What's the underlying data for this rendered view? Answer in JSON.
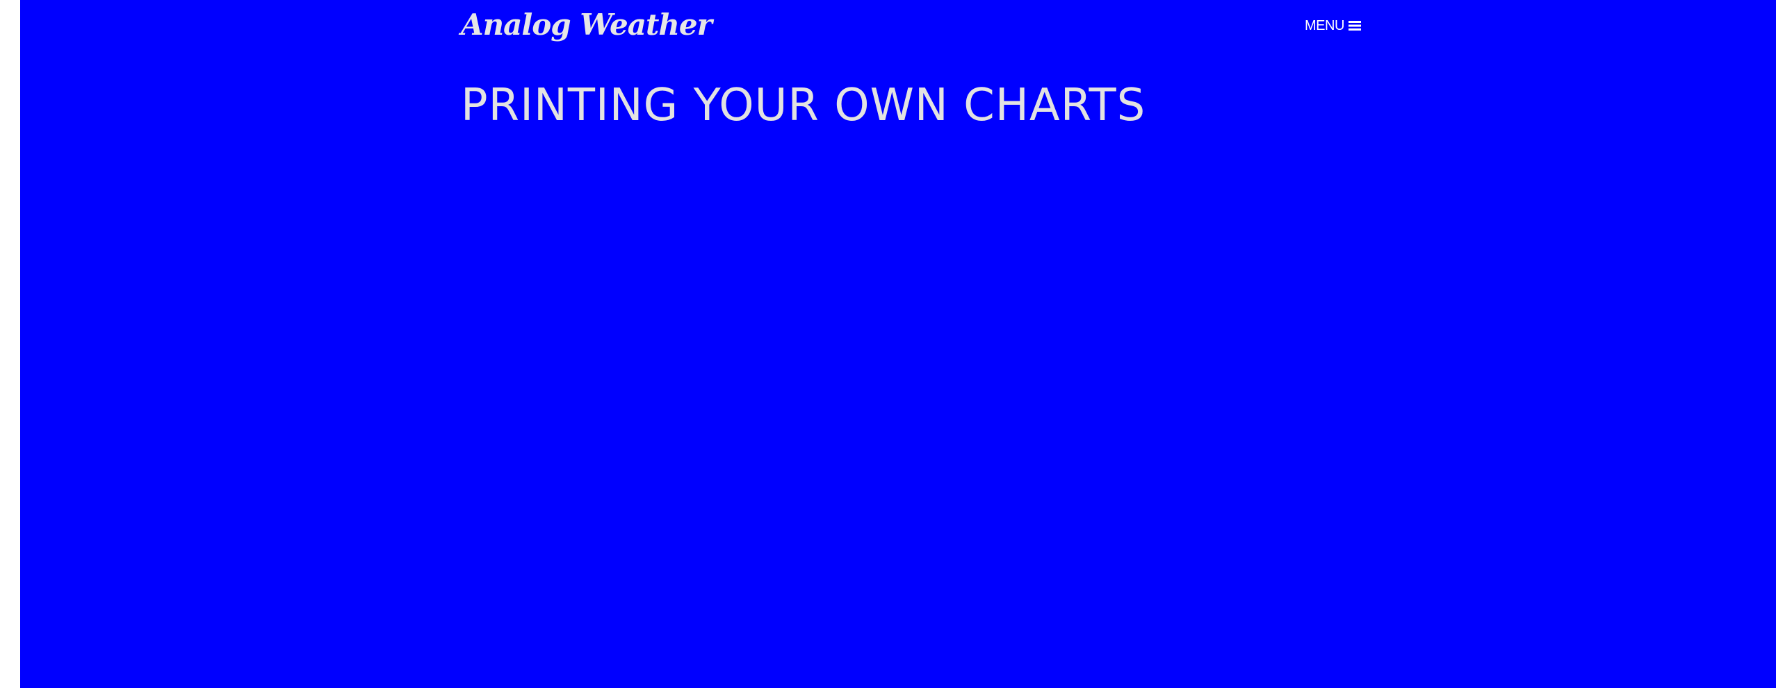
{
  "header": {
    "logo_text": "Analog Weather",
    "menu_label": "MENU",
    "menu_icon": "hamburger-icon"
  },
  "main": {
    "title": "PRINTING YOUR OWN CHARTS"
  },
  "colors": {
    "background": "#0000ff",
    "title_text": "#e2e2e2",
    "menu_text": "#ffffff",
    "outer_margin": "#ffffff"
  }
}
